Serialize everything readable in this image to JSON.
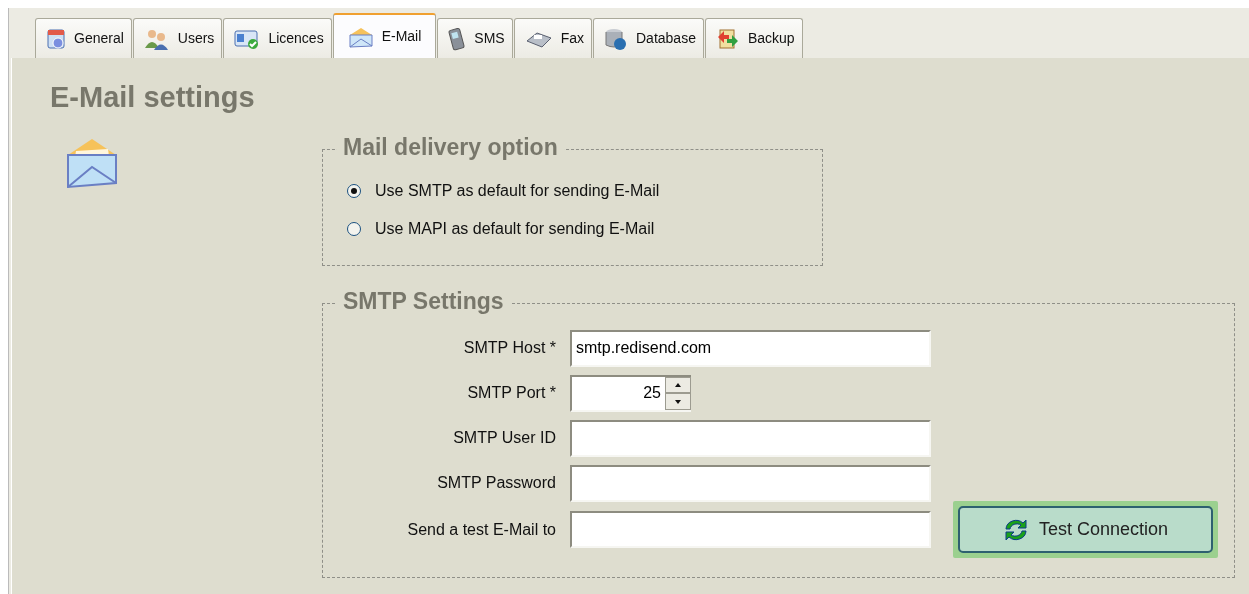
{
  "tabs": [
    {
      "label": "General",
      "selected": false
    },
    {
      "label": "Users",
      "selected": false
    },
    {
      "label": "Licences",
      "selected": false
    },
    {
      "label": "E-Mail",
      "selected": true
    },
    {
      "label": "SMS",
      "selected": false
    },
    {
      "label": "Fax",
      "selected": false
    },
    {
      "label": "Database",
      "selected": false
    },
    {
      "label": "Backup",
      "selected": false
    }
  ],
  "heading": "E-Mail settings",
  "delivery": {
    "legend": "Mail delivery option",
    "options": [
      {
        "label": "Use SMTP as default for sending E-Mail",
        "selected": true
      },
      {
        "label": "Use MAPI as default for sending E-Mail",
        "selected": false
      }
    ]
  },
  "smtp": {
    "legend": "SMTP Settings",
    "fields": [
      {
        "label": "SMTP Host *",
        "kind": "text",
        "value": "smtp.redisend.com"
      },
      {
        "label": "SMTP Port *",
        "kind": "spinner",
        "value": "25"
      },
      {
        "label": "SMTP User ID",
        "kind": "text"
      },
      {
        "label": "SMTP Password",
        "kind": "text"
      },
      {
        "label": "Send a test E-Mail to",
        "kind": "text"
      }
    ],
    "button": "Test Connection"
  }
}
